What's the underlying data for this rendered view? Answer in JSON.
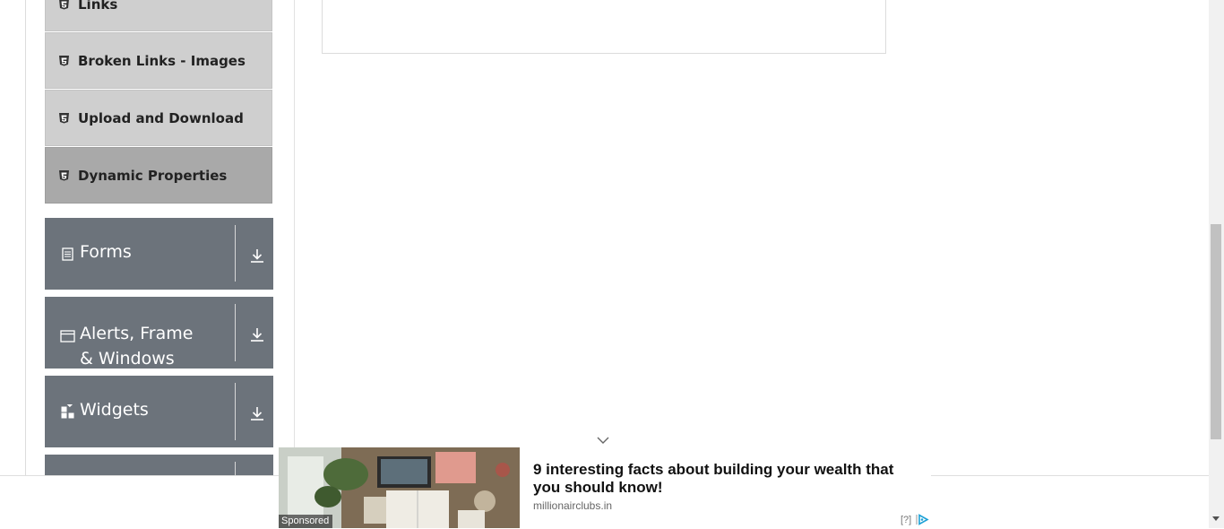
{
  "sidebar": {
    "elements_items": [
      {
        "label": "Links",
        "icon": "html5-icon",
        "active": false
      },
      {
        "label": "Broken Links - Images",
        "icon": "html5-icon",
        "active": false
      },
      {
        "label": "Upload and Download",
        "icon": "html5-icon",
        "active": false
      },
      {
        "label": "Dynamic Properties",
        "icon": "html5-icon",
        "active": true
      }
    ],
    "groups": [
      {
        "label": "Forms",
        "icon": "document-icon"
      },
      {
        "label": "Alerts, Frame & Windows",
        "icon": "window-icon"
      },
      {
        "label": "Widgets",
        "icon": "widgets-icon"
      }
    ]
  },
  "ad": {
    "sponsored_label": "Sponsored",
    "headline": "9 interesting facts about building your wealth that you should know!",
    "domain": "millionairclubs.in",
    "help_label": "[?]",
    "adchoices_icon": "adchoices-icon",
    "collapse_icon": "chevron-down-icon"
  },
  "colors": {
    "group_bg": "#6c737b",
    "item_bg": "#cfcfcf",
    "item_active_bg": "#a9a9a9"
  }
}
